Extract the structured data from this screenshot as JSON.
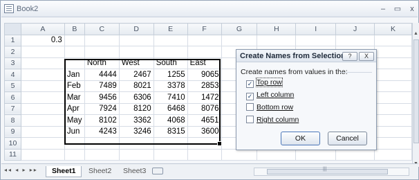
{
  "window": {
    "title": "Book2",
    "minimize": "–",
    "restore": "▭",
    "close": "x"
  },
  "columns": [
    "A",
    "B",
    "C",
    "D",
    "E",
    "F",
    "G",
    "H",
    "I",
    "J",
    "K"
  ],
  "rows": [
    {
      "num": "1",
      "cells": [
        "0.3",
        "",
        "",
        "",
        "",
        "",
        "",
        "",
        "",
        "",
        ""
      ]
    },
    {
      "num": "2",
      "cells": [
        "",
        "",
        "",
        "",
        "",
        "",
        "",
        "",
        "",
        "",
        ""
      ]
    },
    {
      "num": "3",
      "cells": [
        "",
        "",
        "North",
        "West",
        "South",
        "East",
        "",
        "",
        "",
        "",
        ""
      ]
    },
    {
      "num": "4",
      "cells": [
        "",
        "Jan",
        "4444",
        "2467",
        "1255",
        "9065",
        "",
        "",
        "",
        "",
        ""
      ]
    },
    {
      "num": "5",
      "cells": [
        "",
        "Feb",
        "7489",
        "8021",
        "3378",
        "2853",
        "",
        "",
        "",
        "",
        ""
      ]
    },
    {
      "num": "6",
      "cells": [
        "",
        "Mar",
        "9456",
        "6306",
        "7410",
        "1472",
        "",
        "",
        "",
        "",
        ""
      ]
    },
    {
      "num": "7",
      "cells": [
        "",
        "Apr",
        "7924",
        "8120",
        "6468",
        "8076",
        "",
        "",
        "",
        "",
        ""
      ]
    },
    {
      "num": "8",
      "cells": [
        "",
        "May",
        "8102",
        "3362",
        "4068",
        "4651",
        "",
        "",
        "",
        "",
        ""
      ]
    },
    {
      "num": "9",
      "cells": [
        "",
        "Jun",
        "4243",
        "3246",
        "8315",
        "3600",
        "",
        "",
        "",
        "",
        ""
      ]
    },
    {
      "num": "10",
      "cells": [
        "",
        "",
        "",
        "",
        "",
        "",
        "",
        "",
        "",
        "",
        ""
      ]
    },
    {
      "num": "11",
      "cells": [
        "",
        "",
        "",
        "",
        "",
        "",
        "",
        "",
        "",
        "",
        ""
      ]
    }
  ],
  "tabs": {
    "nav": "◂◂ ◂ ▸ ▸▸",
    "sheets": [
      "Sheet1",
      "Sheet2",
      "Sheet3"
    ],
    "active": "Sheet1"
  },
  "dialog": {
    "title": "Create Names from Selection",
    "help": "?",
    "close": "X",
    "prompt": "Create names from values in the:",
    "options": [
      {
        "label": "Top row",
        "checked": true
      },
      {
        "label": "Left column",
        "checked": true
      },
      {
        "label": "Bottom row",
        "checked": false
      },
      {
        "label": "Right column",
        "checked": false
      }
    ],
    "ok": "OK",
    "cancel": "Cancel"
  },
  "icons": [
    "workbook-icon",
    "insert-sheet-icon",
    "scroll-arrow-icon"
  ]
}
